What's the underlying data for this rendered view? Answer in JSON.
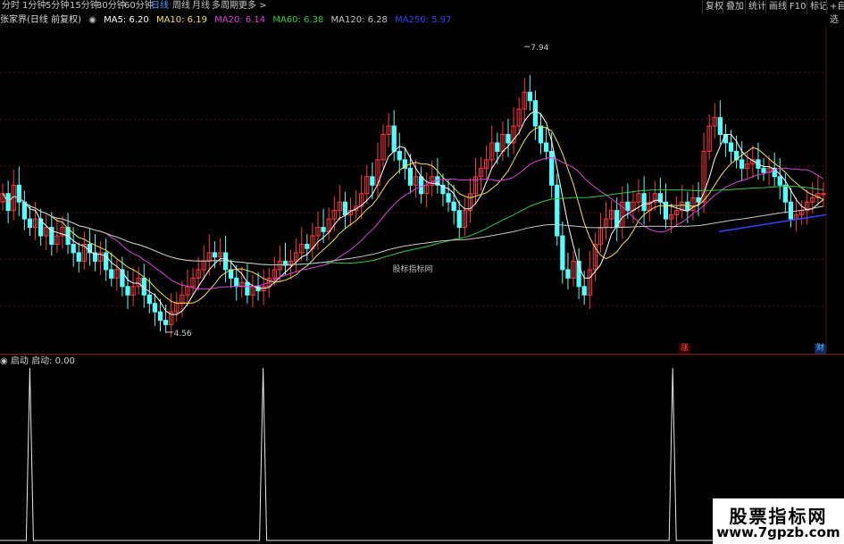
{
  "toolbar": {
    "periods": [
      {
        "label": "分时",
        "active": false
      },
      {
        "label": "1分钟",
        "active": false
      },
      {
        "label": "5分钟",
        "active": false
      },
      {
        "label": "15分钟",
        "active": false
      },
      {
        "label": "30分钟",
        "active": false
      },
      {
        "label": "60分钟",
        "active": false
      },
      {
        "label": "日线",
        "active": true
      },
      {
        "label": "周线",
        "active": false
      },
      {
        "label": "月线",
        "active": false
      },
      {
        "label": "多周期",
        "active": false
      },
      {
        "label": "更多 >",
        "active": false
      }
    ],
    "tools": [
      "复权",
      "叠加",
      "统计",
      "画线",
      "F10",
      "标记",
      "+自选"
    ]
  },
  "main_legend": {
    "title": "张家界(日线 前复权)",
    "ma5": "MA5: 6.20",
    "ma10": "MA10: 6.19",
    "ma20": "MA20: 6.14",
    "ma60": "MA60: 6.38",
    "ma120": "MA120: 6.28",
    "ma250": "MA250: 5.97"
  },
  "colors": {
    "up": "#ff3a3a",
    "down": "#54ffff",
    "ma5": "#ffffff",
    "ma10": "#f5e34a",
    "ma20": "#e040e0",
    "ma60": "#2ecc40",
    "ma120": "#c8c8c8",
    "ma250": "#3344ff",
    "grid": "#5a1010"
  },
  "price_labels": {
    "high": "7.94",
    "low": "4.56"
  },
  "center_watermark": "股标指标网",
  "markers": {
    "zhang": "涨",
    "cai": "财"
  },
  "sub_legend": {
    "name": "启动",
    "value_text": "启动: 0.00"
  },
  "chart_data": {
    "type": "candlestick",
    "y_range": [
      4.4,
      8.1
    ],
    "price_marks": {
      "high": 7.94,
      "low": 4.56
    },
    "closes": [
      6.2,
      6.0,
      6.3,
      6.1,
      5.9,
      5.8,
      5.9,
      5.7,
      5.8,
      5.6,
      5.7,
      5.8,
      5.6,
      5.5,
      5.4,
      5.6,
      5.5,
      5.4,
      5.5,
      5.3,
      5.2,
      5.3,
      5.1,
      5.0,
      5.1,
      5.2,
      5.0,
      4.9,
      4.8,
      4.7,
      4.65,
      4.8,
      4.9,
      5.0,
      5.1,
      5.2,
      5.3,
      5.4,
      5.5,
      5.45,
      5.5,
      5.3,
      5.2,
      5.1,
      5.15,
      5.0,
      5.1,
      5.05,
      5.1,
      5.2,
      5.3,
      5.4,
      5.35,
      5.4,
      5.5,
      5.6,
      5.55,
      5.7,
      5.8,
      5.75,
      5.9,
      6.0,
      6.1,
      5.95,
      6.0,
      6.05,
      6.2,
      6.4,
      6.3,
      6.6,
      6.9,
      7.0,
      6.7,
      6.6,
      6.5,
      6.3,
      6.4,
      6.2,
      6.3,
      6.4,
      6.3,
      6.2,
      6.1,
      6.0,
      5.8,
      6.0,
      6.2,
      6.4,
      6.5,
      6.6,
      6.8,
      6.7,
      6.9,
      6.8,
      7.0,
      7.2,
      7.4,
      7.3,
      7.0,
      6.8,
      6.7,
      6.3,
      5.7,
      5.3,
      5.2,
      5.4,
      5.1,
      5.0,
      5.3,
      5.6,
      5.8,
      5.9,
      6.0,
      5.8,
      6.1,
      6.0,
      6.1,
      6.2,
      6.0,
      6.1,
      6.2,
      6.1,
      5.9,
      5.95,
      6.0,
      6.1,
      6.0,
      6.15,
      6.1,
      6.7,
      7.0,
      7.1,
      6.9,
      6.8,
      6.7,
      6.6,
      6.5,
      6.55,
      6.6,
      6.5,
      6.45,
      6.5,
      6.4,
      6.3,
      6.1,
      5.9,
      5.95,
      6.0,
      6.1,
      6.15,
      6.2,
      6.2
    ],
    "ma_last": {
      "MA5": 6.2,
      "MA10": 6.19,
      "MA20": 6.14,
      "MA60": 6.38,
      "MA120": 6.28,
      "MA250": 5.97
    }
  },
  "sub_chart_data": {
    "type": "line",
    "value": 0.0,
    "spikes_at_bar_index": [
      12,
      106,
      271
    ],
    "bar_count": 340
  }
}
